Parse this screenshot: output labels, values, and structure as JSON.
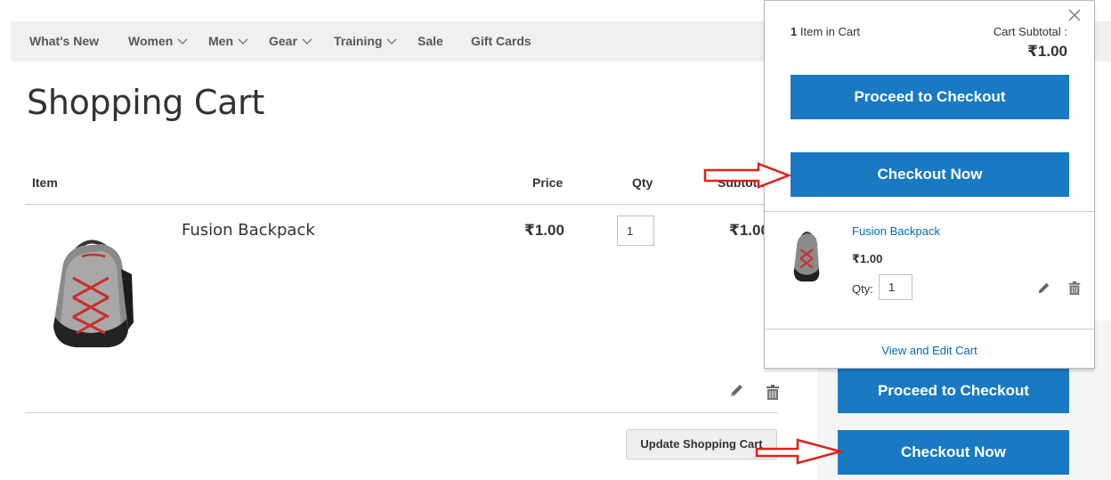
{
  "nav": {
    "items": [
      {
        "label": "What's New",
        "dropdown": false
      },
      {
        "label": "Women",
        "dropdown": true
      },
      {
        "label": "Men",
        "dropdown": true
      },
      {
        "label": "Gear",
        "dropdown": true
      },
      {
        "label": "Training",
        "dropdown": true
      },
      {
        "label": "Sale",
        "dropdown": false
      },
      {
        "label": "Gift Cards",
        "dropdown": false
      }
    ]
  },
  "page": {
    "title": "Shopping Cart"
  },
  "cart": {
    "headers": {
      "item": "Item",
      "price": "Price",
      "qty": "Qty",
      "subtotal": "Subtotal"
    },
    "row": {
      "name": "Fusion Backpack",
      "price": "₹1.00",
      "qty": "1",
      "subtotal": "₹1.00"
    },
    "update_label": "Update Shopping Cart"
  },
  "summary": {
    "proceed_label": "Proceed to Checkout",
    "checkout_now_label": "Checkout Now"
  },
  "minicart": {
    "count": "1",
    "count_text": "Item in Cart",
    "subtotal_label": "Cart Subtotal :",
    "subtotal_value": "₹1.00",
    "proceed_label": "Proceed to Checkout",
    "checkout_now_label": "Checkout Now",
    "item": {
      "name": "Fusion Backpack",
      "price": "₹1.00",
      "qty_label": "Qty:",
      "qty": "1"
    },
    "view_edit_label": "View and Edit Cart"
  },
  "colors": {
    "accent": "#1979c3",
    "link": "#006bb4",
    "arrow_red": "#e0201c",
    "nav_bg": "#f0f0f0"
  },
  "icons": [
    "chevron-down-icon",
    "pencil-icon",
    "trash-icon",
    "close-icon"
  ]
}
